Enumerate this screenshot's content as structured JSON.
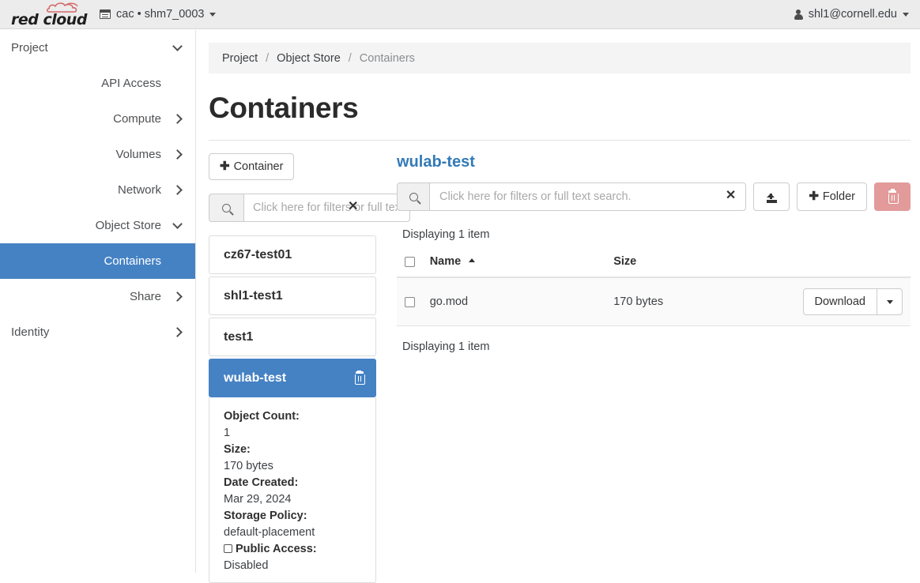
{
  "header": {
    "brand": "red cloud",
    "project_selector": "cac • shm7_0003",
    "user": "shl1@cornell.edu"
  },
  "sidebar": {
    "items": [
      {
        "label": "Project",
        "level": 0,
        "chevron": "down",
        "selected": false
      },
      {
        "label": "API Access",
        "level": 1,
        "chevron": "none",
        "selected": false
      },
      {
        "label": "Compute",
        "level": 1,
        "chevron": "right",
        "selected": false
      },
      {
        "label": "Volumes",
        "level": 1,
        "chevron": "right",
        "selected": false
      },
      {
        "label": "Network",
        "level": 1,
        "chevron": "right",
        "selected": false
      },
      {
        "label": "Object Store",
        "level": 1,
        "chevron": "down",
        "selected": false
      },
      {
        "label": "Containers",
        "level": 2,
        "chevron": "none",
        "selected": true
      },
      {
        "label": "Share",
        "level": 1,
        "chevron": "right",
        "selected": false
      },
      {
        "label": "Identity",
        "level": 0,
        "chevron": "right",
        "selected": false
      }
    ]
  },
  "breadcrumb": {
    "items": [
      "Project",
      "Object Store",
      "Containers"
    ],
    "separator": "/"
  },
  "page": {
    "title": "Containers"
  },
  "containers_panel": {
    "add_button": "Container",
    "add_icon": "plus-icon",
    "filter_placeholder": "Click here for filters or full text search.",
    "filter_value": "",
    "filter_clear_icon": "clear-icon",
    "search_icon": "search-icon",
    "items": [
      {
        "name": "cz67-test01",
        "selected": false
      },
      {
        "name": "shl1-test1",
        "selected": false
      },
      {
        "name": "test1",
        "selected": false
      },
      {
        "name": "wulab-test",
        "selected": true
      }
    ],
    "delete_icon": "trash-icon",
    "details": [
      {
        "label": "Object Count:",
        "value": "1",
        "checkbox": false
      },
      {
        "label": "Size:",
        "value": "170 bytes",
        "checkbox": false
      },
      {
        "label": "Date Created:",
        "value": "Mar 29, 2024",
        "checkbox": false
      },
      {
        "label": "Storage Policy:",
        "value": "default-placement",
        "checkbox": false
      },
      {
        "label": "Public Access:",
        "value": "Disabled",
        "checkbox": true
      }
    ]
  },
  "objects_panel": {
    "container_name": "wulab-test",
    "search_placeholder": "Click here for filters or full text search.",
    "search_value": "",
    "search_icon": "search-icon",
    "search_clear_icon": "clear-icon",
    "upload_icon": "upload-icon",
    "folder_button": "Folder",
    "folder_icon": "plus-icon",
    "delete_icon": "trash-icon",
    "count_top": "Displaying 1 item",
    "count_bottom": "Displaying 1 item",
    "columns": [
      "Name",
      "Size"
    ],
    "sort_column": "Name",
    "sort_direction": "asc",
    "rows": [
      {
        "name": "go.mod",
        "size": "170 bytes",
        "action_label": "Download",
        "checked": false
      }
    ]
  },
  "colors": {
    "accent_blue": "#4582c4",
    "link_blue": "#337ab7",
    "danger": "#e39a9a",
    "header_bg": "#ececec",
    "breadcrumb_bg": "#f4f4f4"
  }
}
